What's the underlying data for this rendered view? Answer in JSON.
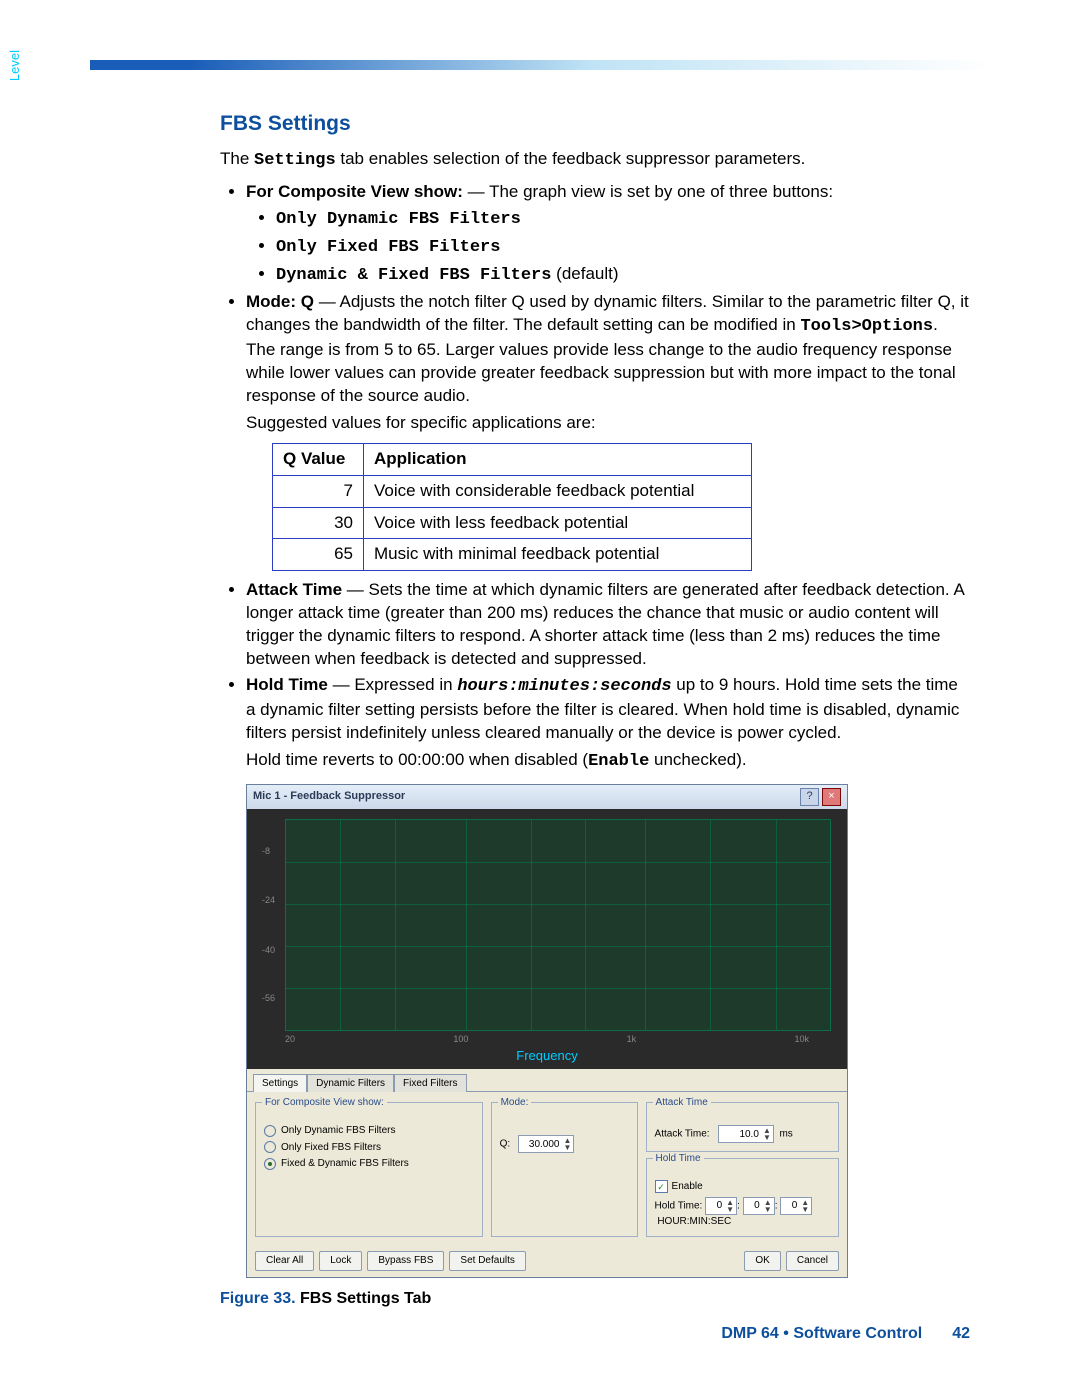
{
  "heading": "FBS Settings",
  "intro_pre": "The ",
  "intro_code": "Settings",
  "intro_post": " tab enables selection of the feedback suppressor parameters.",
  "composite": {
    "label_b": "For Composite View show:",
    "label_rest": " — The graph view is set by one of three buttons:",
    "opts": [
      "Only Dynamic FBS Filters",
      "Only Fixed FBS Filters"
    ],
    "opt3_b": "Dynamic & Fixed FBS Filters",
    "opt3_rest": " (default)"
  },
  "modeq": {
    "b": "Mode: Q",
    "t1": " — Adjusts the notch filter Q used by dynamic filters. Similar to the parametric filter Q, it changes the bandwidth of the filter. The default setting can be modified in ",
    "code": "Tools>Options",
    "t2": ". The range is from 5 to 65. Larger values provide less change to the audio frequency response while lower values can provide greater feedback suppression but with more impact to the tonal response of the source audio.",
    "sug": "Suggested values for specific applications are:"
  },
  "table": {
    "h1": "Q Value",
    "h2": "Application",
    "rows": [
      {
        "q": "7",
        "a": "Voice with considerable feedback potential"
      },
      {
        "q": "30",
        "a": "Voice with less feedback potential"
      },
      {
        "q": "65",
        "a": "Music with minimal feedback potential"
      }
    ]
  },
  "attack": {
    "b": "Attack Time",
    "t": " — Sets the time at which dynamic filters are generated after feedback detection. A longer attack time (greater than 200 ms) reduces the chance that music or audio content will trigger the dynamic filters to respond. A shorter attack time (less than 2 ms) reduces the time between when feedback is detected and suppressed."
  },
  "hold": {
    "b": "Hold Time",
    "t1": " — Expressed in ",
    "code": "hours:minutes:seconds",
    "t2": " up to 9 hours. Hold time sets the time a dynamic filter setting persists before the filter is cleared. When hold time is disabled, dynamic filters persist indefinitely unless cleared manually or the device is power cycled.",
    "rev1": "Hold time reverts to 00:00:00 when disabled (",
    "rev_code": "Enable",
    "rev2": " unchecked)."
  },
  "app": {
    "title": "Mic 1 - Feedback Suppressor",
    "yaxis": "Level",
    "xaxis": "Frequency",
    "yticks": [
      "-8",
      "-24",
      "-40",
      "-56"
    ],
    "xticks": [
      "20",
      "100",
      "1k",
      "10k"
    ],
    "tabs": [
      "Settings",
      "Dynamic Filters",
      "Fixed Filters"
    ],
    "grp_comp": "For Composite View show:",
    "radios": [
      "Only Dynamic FBS Filters",
      "Only Fixed FBS Filters",
      "Fixed & Dynamic FBS Filters"
    ],
    "grp_mode": "Mode:",
    "q_label": "Q:",
    "q_val": "30.000",
    "grp_attack": "Attack Time",
    "attack_label": "Attack Time:",
    "attack_val": "10.0",
    "attack_unit": "ms",
    "grp_hold": "Hold Time",
    "enable": "Enable",
    "hold_label": "Hold Time:",
    "hold_vals": [
      "0",
      "0",
      "0"
    ],
    "hold_unit": "HOUR:MIN:SEC",
    "btns": [
      "Clear All",
      "Lock",
      "Bypass FBS",
      "Set Defaults"
    ],
    "ok": "OK",
    "cancel": "Cancel"
  },
  "figure": {
    "num": "Figure 33.",
    "title": "   FBS Settings Tab"
  },
  "footer": {
    "doc": "DMP 64 • Software Control",
    "page": "42"
  }
}
